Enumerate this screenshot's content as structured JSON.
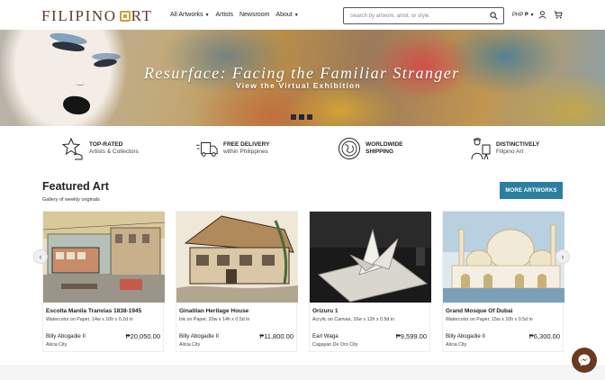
{
  "header": {
    "logo": "FILIPINO ART",
    "logo_left": "FILIPINO",
    "logo_right": "RT",
    "nav": [
      {
        "label": "All Artworks",
        "dropdown": true
      },
      {
        "label": "Artists",
        "dropdown": false
      },
      {
        "label": "Newsroom",
        "dropdown": false
      },
      {
        "label": "About",
        "dropdown": true
      }
    ],
    "search_placeholder": "Search by artwork, artist, or style.",
    "currency": "PHP ₱",
    "icons": {
      "search": "search-icon",
      "user": "user-icon",
      "cart": "cart-icon"
    }
  },
  "hero": {
    "title": "Resurface: Facing the Familiar Stranger",
    "subtitle": "View the Virtual Exhibition",
    "slides": 3,
    "active_slide": 2
  },
  "features": [
    {
      "title": "TOP-RATED",
      "subtitle": "Artists & Collectors",
      "icon": "star-hand-icon"
    },
    {
      "title": "FREE DELIVERY",
      "subtitle": "within Philippines",
      "icon": "truck-icon"
    },
    {
      "title": "WORLDWIDE",
      "subtitle": "SHIPPING",
      "icon": "globe-icon"
    },
    {
      "title": "DISTINCTIVELY",
      "subtitle": "Filipino Art",
      "icon": "painter-icon"
    }
  ],
  "featured": {
    "title": "Featured Art",
    "subtitle": "Gallery of weekly originals",
    "more_button": "MORE ARTWORKS",
    "cards": [
      {
        "title": "Escolta Manila Tranvias 1838-1945",
        "medium": "Watercolor on Paper, 14w x 10h x 0.2d in",
        "artist": "Billy Abogadie II",
        "price": "₱20,050.00",
        "location": "Alicia City"
      },
      {
        "title": "Ginatilan Heritage House",
        "medium": "Ink on Paper, 20w x 14h x 0.5d in",
        "artist": "Billy Abogadie II",
        "price": "₱11,800.00",
        "location": "Alicia City"
      },
      {
        "title": "Orizuru 1",
        "medium": "Acrylic on Canvas, 16w x 12h x 0.5d in",
        "artist": "Earl Waga",
        "price": "₱9,599.00",
        "location": "Cagayan De Oro City"
      },
      {
        "title": "Grand Mosque Of Dubai",
        "medium": "Watercolor on Paper, 15w x 10h x 0.5d in",
        "artist": "Billy Abogadie II",
        "price": "₱6,300.00",
        "location": "Alicia City"
      }
    ]
  },
  "colors": {
    "brand_brown": "#5b3a29",
    "brand_gold": "#c9a23a",
    "button_teal": "#2a7fa0",
    "messenger": "#6b3a1f"
  }
}
